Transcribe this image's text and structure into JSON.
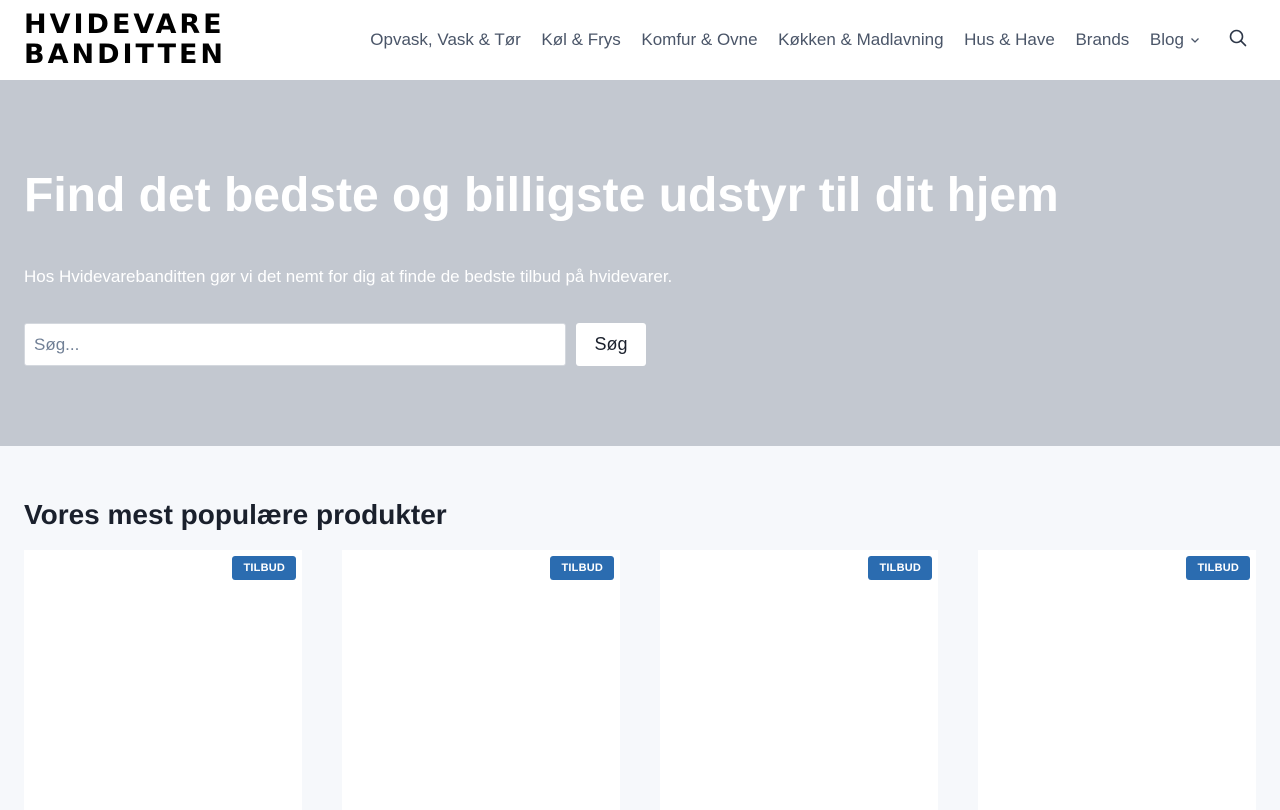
{
  "header": {
    "logo": {
      "line1": "HVIDEVARE",
      "line2": "BANDITTEN"
    },
    "nav": [
      {
        "label": "Opvask, Vask & Tør"
      },
      {
        "label": "Køl & Frys"
      },
      {
        "label": "Komfur & Ovne"
      },
      {
        "label": "Køkken & Madlavning"
      },
      {
        "label": "Hus & Have"
      },
      {
        "label": "Brands"
      },
      {
        "label": "Blog",
        "has_dropdown": true
      }
    ],
    "search_icon": "search-icon"
  },
  "hero": {
    "title": "Find det bedste og billigste udstyr til dit hjem",
    "subtitle": "Hos Hvidevarebanditten gør vi det nemt for dig at finde de bedste tilbud på hvidevarer.",
    "search": {
      "placeholder": "Søg...",
      "value": "",
      "button_label": "Søg"
    }
  },
  "products": {
    "title": "Vores mest populære produkter",
    "items": [
      {
        "badge": "TILBUD"
      },
      {
        "badge": "TILBUD"
      },
      {
        "badge": "TILBUD"
      },
      {
        "badge": "TILBUD"
      }
    ]
  },
  "colors": {
    "hero_bg": "#c3c8d0",
    "page_bg": "#f6f8fb",
    "badge_bg": "#2b6cb0",
    "nav_text": "#4a5568"
  }
}
